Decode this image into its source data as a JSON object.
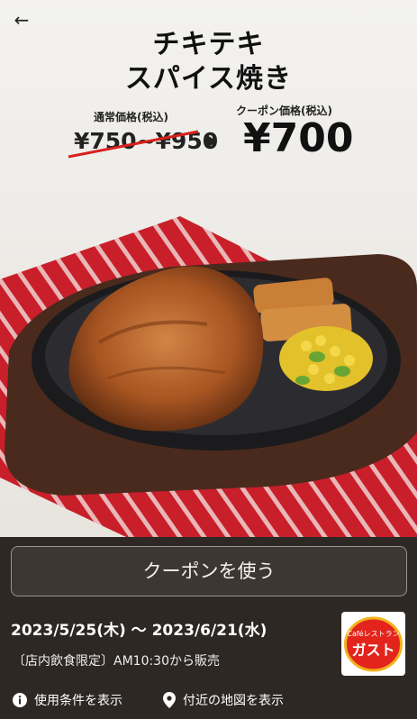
{
  "header": {
    "back_icon": "arrow-left-icon",
    "title_line1": "チキテキ",
    "title_line2": "スパイス焼き"
  },
  "prices": {
    "normal_label": "通常価格(税込)",
    "normal_price": "¥750~¥950",
    "coupon_label": "クーポン価格(税込)",
    "coupon_price": "¥700"
  },
  "coupon": {
    "use_button": "クーポンを使う",
    "period": "2023/5/25(木) 〜 2023/6/21(水)",
    "note": "〔店内飲食限定〕AM10:30から販売"
  },
  "brand": {
    "logo_small": "Caféレストラン",
    "logo_main": "ガスト"
  },
  "footer": {
    "terms_link": "使用条件を表示",
    "map_link": "付近の地図を表示"
  }
}
